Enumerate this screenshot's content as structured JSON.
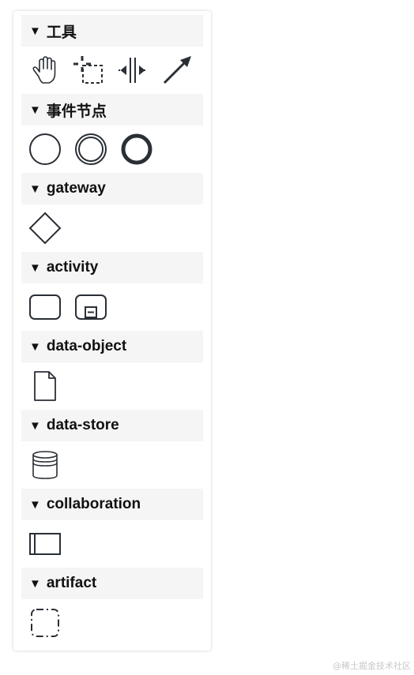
{
  "groups": [
    {
      "title": "工具",
      "caret": "▼"
    },
    {
      "title": "事件节点",
      "caret": "▼"
    },
    {
      "title": "gateway",
      "caret": "▼"
    },
    {
      "title": "activity",
      "caret": "▼"
    },
    {
      "title": "data-object",
      "caret": "▼"
    },
    {
      "title": "data-store",
      "caret": "▼"
    },
    {
      "title": "collaboration",
      "caret": "▼"
    },
    {
      "title": "artifact",
      "caret": "▼"
    }
  ],
  "watermark": "@稀土掘金技术社区",
  "colors": {
    "header_bg": "#f5f5f5",
    "icon_stroke": "#2a2f36",
    "panel_bg": "#ffffff"
  }
}
